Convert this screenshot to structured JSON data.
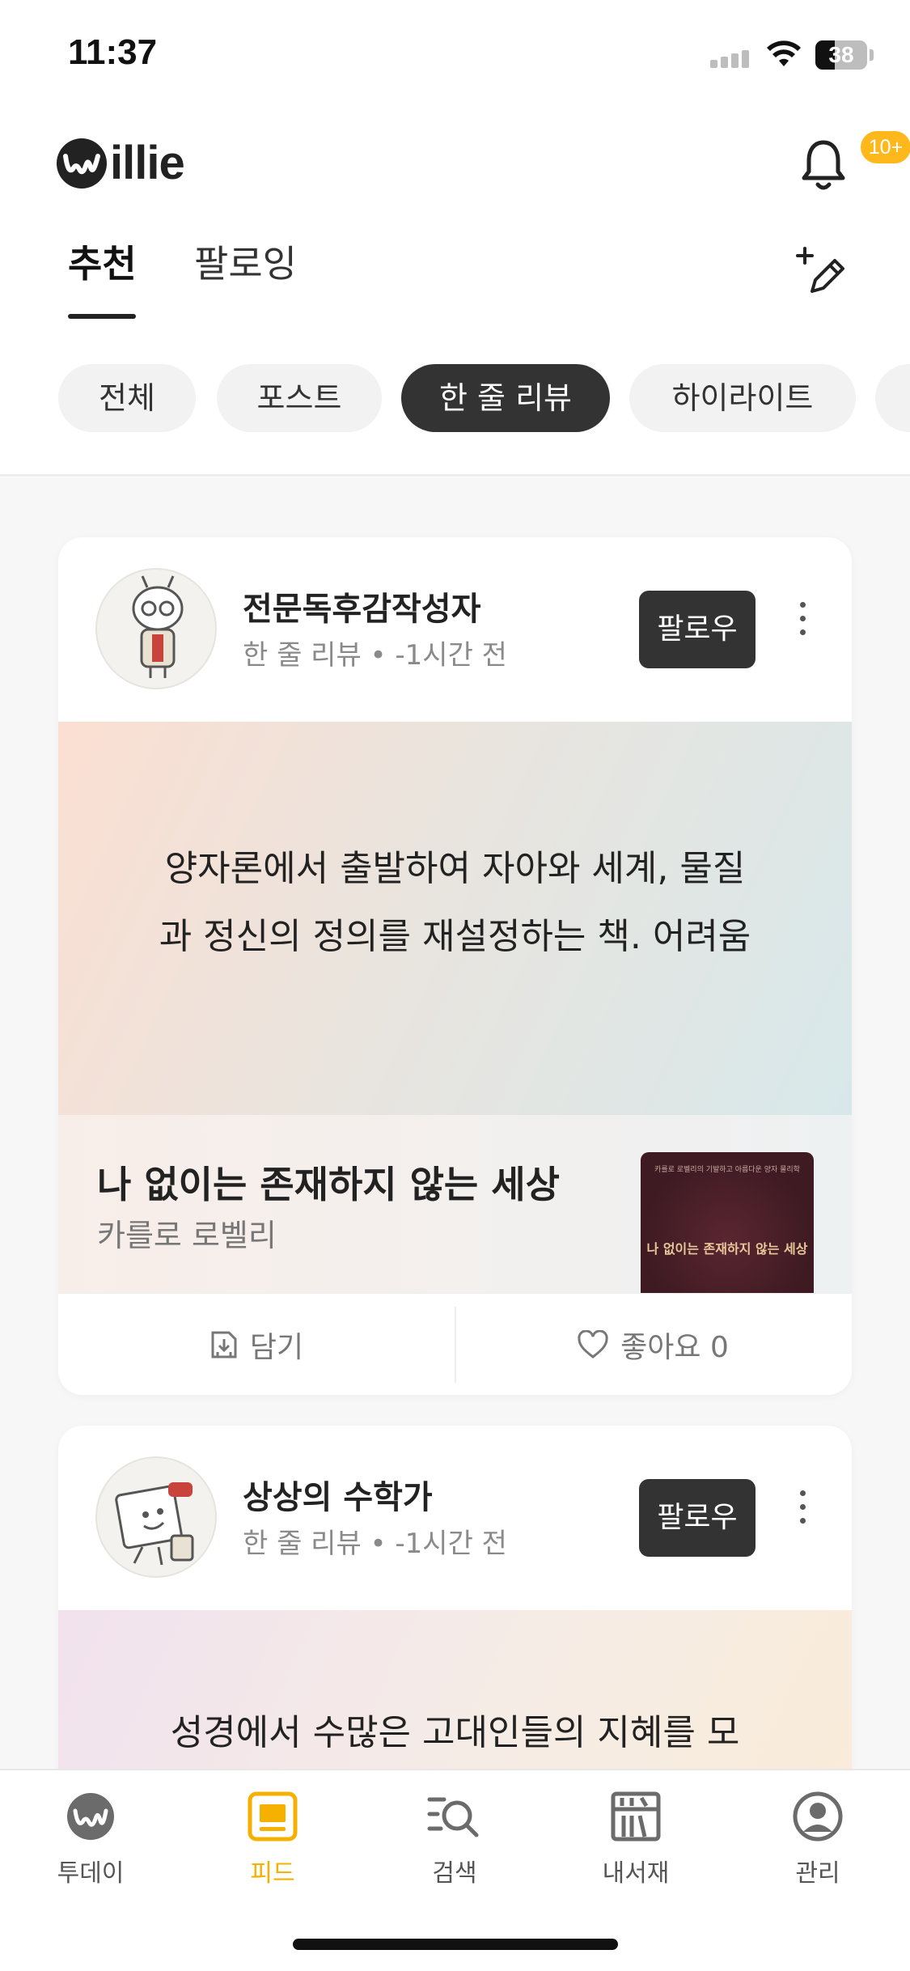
{
  "status_bar": {
    "time": "11:37",
    "battery": "38",
    "battery_level": 0.38
  },
  "header": {
    "logo_text": "illie",
    "notification_badge": "10+",
    "tabs": [
      {
        "label": "추천",
        "active": true
      },
      {
        "label": "팔로잉",
        "active": false
      }
    ],
    "chips": [
      {
        "label": "전체",
        "active": false
      },
      {
        "label": "포스트",
        "active": false
      },
      {
        "label": "한 줄 리뷰",
        "active": true
      },
      {
        "label": "하이라이트",
        "active": false
      }
    ]
  },
  "feed": [
    {
      "author": "전문독후감작성자",
      "meta": "한 줄 리뷰 • -1시간 전",
      "follow_label": "팔로우",
      "quote_line1": "양자론에서 출발하여 자아와 세계, 물질",
      "quote_line2": "과 정신의 정의를 재설정하는 책. 어려움",
      "book_title": "나 없이는 존재하지 않는 세상",
      "book_author": "카를로 로벨리",
      "cover_tagline": "카를로 로벨리의 기발하고 아름다운 양자 물리학",
      "cover_title": "나 없이는 존재하지 않는 세상",
      "save_label": "담기",
      "like_label": "좋아요 0"
    },
    {
      "author": "상상의 수학가",
      "meta": "한 줄 리뷰 • -1시간 전",
      "follow_label": "팔로우",
      "quote_line1": "성경에서 수많은 고대인들의 지혜를 모"
    }
  ],
  "bottom_nav": [
    {
      "label": "투데이",
      "icon": "willie-logo-icon",
      "active": false
    },
    {
      "label": "피드",
      "icon": "feed-icon",
      "active": true
    },
    {
      "label": "검색",
      "icon": "search-icon",
      "active": false
    },
    {
      "label": "내서재",
      "icon": "bookshelf-icon",
      "active": false
    },
    {
      "label": "관리",
      "icon": "profile-icon",
      "active": false
    }
  ],
  "colors": {
    "accent": "#f5b000",
    "badge": "#ffb81c",
    "dark": "#333333"
  }
}
